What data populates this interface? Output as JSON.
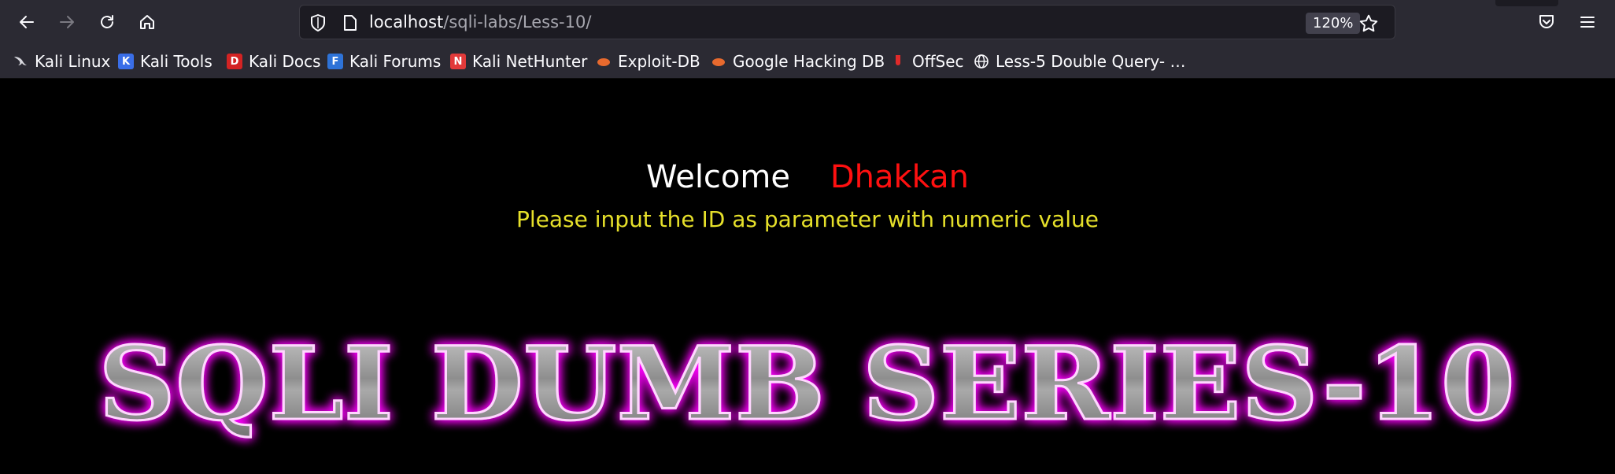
{
  "browser": {
    "url_host": "localhost",
    "url_path": "/sqli-labs/Less-10/",
    "zoom": "120%"
  },
  "bookmarks": [
    {
      "label": "Kali Linux",
      "icon": "kali-dragon-icon",
      "color": "#7d7d85"
    },
    {
      "label": "Kali Tools",
      "icon": "kali-tools-icon",
      "color": "#3a6ee8"
    },
    {
      "label": "Kali Docs",
      "icon": "kali-docs-icon",
      "color": "#d32323"
    },
    {
      "label": "Kali Forums",
      "icon": "kali-forums-icon",
      "color": "#2e73d8"
    },
    {
      "label": "Kali NetHunter",
      "icon": "nethunter-icon",
      "color": "#e23a3a"
    },
    {
      "label": "Exploit-DB",
      "icon": "exploit-db-icon",
      "color": "#e86a2e"
    },
    {
      "label": "Google Hacking DB",
      "icon": "ghdb-icon",
      "color": "#e86a2e"
    },
    {
      "label": "OffSec",
      "icon": "offsec-icon",
      "color": "#e02a2a"
    },
    {
      "label": "Less-5 Double Query- …",
      "icon": "globe-icon",
      "color": "#fbfbfe"
    }
  ],
  "page": {
    "welcome": "Welcome",
    "user": "Dhakkan",
    "instruction": "Please input the ID as parameter with numeric value",
    "banner": "SQLI DUMB SERIES-10",
    "colors": {
      "welcome": "#ffffff",
      "user": "#ff1010",
      "instruction": "#e6e02a",
      "banner_glow": "#ff00ff",
      "banner_fill": "#9a9a9a"
    }
  }
}
